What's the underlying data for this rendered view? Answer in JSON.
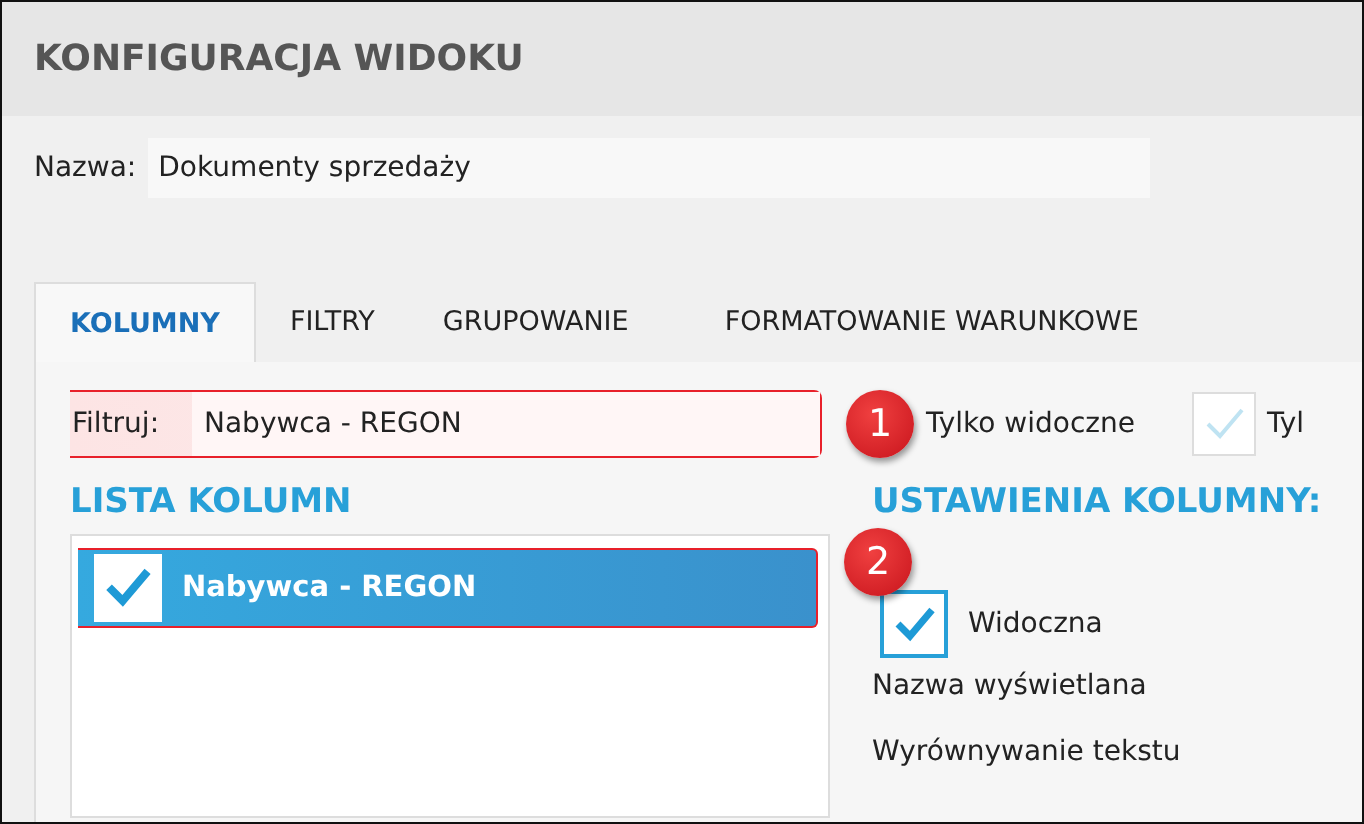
{
  "window": {
    "title": "KONFIGURACJA WIDOKU"
  },
  "name_field": {
    "label": "Nazwa:",
    "value": "Dokumenty sprzedaży"
  },
  "tabs": [
    {
      "label": "KOLUMNY",
      "selected": true
    },
    {
      "label": "FILTRY",
      "selected": false
    },
    {
      "label": "GRUPOWANIE",
      "selected": false
    },
    {
      "label": "FORMATOWANIE WARUNKOWE",
      "selected": false
    }
  ],
  "filter": {
    "label": "Filtruj:",
    "value": "Nabywca - REGON",
    "callout": "1"
  },
  "options": [
    {
      "label": "Tylko widoczne"
    },
    {
      "label": "Tyl",
      "kind": "checkbox",
      "checked": true,
      "disabled": true
    }
  ],
  "column_list": {
    "heading": "LISTA KOLUMN",
    "items": [
      {
        "label": "Nabywca - REGON",
        "checked": true,
        "selected": true,
        "callout": "2"
      }
    ]
  },
  "column_settings": {
    "heading": "USTAWIENIA KOLUMNY:",
    "visible": {
      "label": "Widoczna",
      "checked": true
    },
    "fields": [
      "Nazwa wyświetlana",
      "Wyrównywanie tekstu"
    ]
  }
}
